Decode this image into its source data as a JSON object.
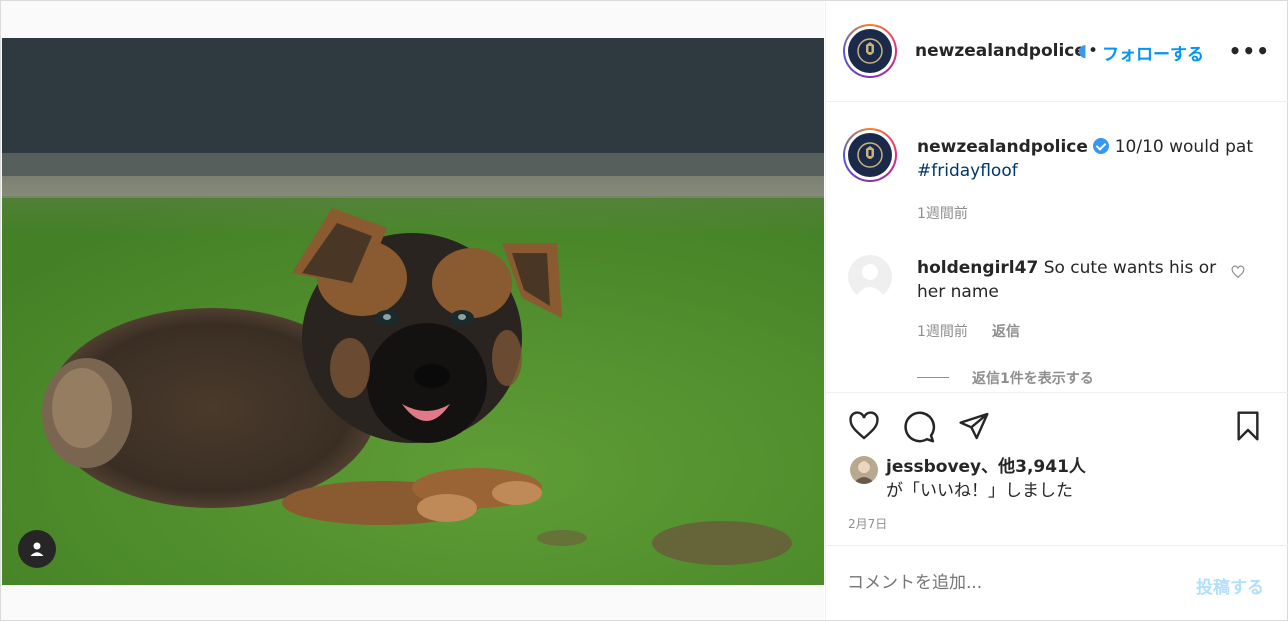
{
  "post": {
    "photo_alt": "",
    "colors": {
      "accent": "#0095f6",
      "hashtag": "#00376b",
      "muted": "#8e8e8e"
    }
  },
  "header": {
    "username": "newzealandpolice",
    "separator": "•",
    "follow_label": "フォローする",
    "more_label": "•••"
  },
  "caption": {
    "username": "newzealandpolice",
    "text": "10/10 would pat",
    "hashtag": "#fridayfloof",
    "time": "1週間前"
  },
  "comments": [
    {
      "username": "holdengirl47",
      "text": "So cute wants his or her name",
      "time": "1週間前",
      "reply_label": "返信",
      "view_replies_label": "返信1件を表示する"
    }
  ],
  "actions": {
    "icons": [
      "heart-icon",
      "comment-icon",
      "share-icon",
      "bookmark-icon"
    ]
  },
  "likes": {
    "liker": "jessbovey",
    "others": "、他3,941人",
    "suffix": "が「いいね！」しました",
    "date": "2月7日"
  },
  "add_comment": {
    "placeholder": "コメントを追加...",
    "post_label": "投稿する"
  }
}
